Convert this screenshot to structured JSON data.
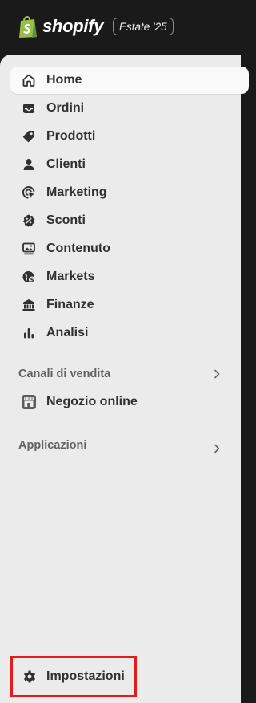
{
  "header": {
    "brand": "shopify",
    "edition_badge": "Estate '25",
    "brand_color": "#95bf47"
  },
  "sidebar": {
    "items": [
      {
        "label": "Home",
        "icon": "home-icon",
        "active": true
      },
      {
        "label": "Ordini",
        "icon": "inbox-icon"
      },
      {
        "label": "Prodotti",
        "icon": "tag-icon"
      },
      {
        "label": "Clienti",
        "icon": "person-icon"
      },
      {
        "label": "Marketing",
        "icon": "target-icon"
      },
      {
        "label": "Sconti",
        "icon": "discount-icon"
      },
      {
        "label": "Contenuto",
        "icon": "image-monitor-icon"
      },
      {
        "label": "Markets",
        "icon": "globe-icon"
      },
      {
        "label": "Finanze",
        "icon": "bank-icon"
      },
      {
        "label": "Analisi",
        "icon": "bar-chart-icon"
      }
    ],
    "sales_channels": {
      "label": "Canali di vendita",
      "items": [
        {
          "label": "Negozio online",
          "icon": "storefront-icon"
        }
      ]
    },
    "apps": {
      "label": "Applicazioni"
    },
    "settings": {
      "label": "Impostazioni",
      "icon": "gear-icon"
    }
  }
}
